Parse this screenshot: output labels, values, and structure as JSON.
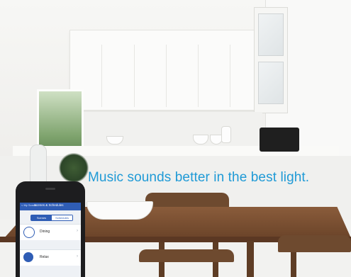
{
  "advert": {
    "tagline": "Music sounds better in the best light."
  },
  "phone_app": {
    "nav_back": "< My Sonos",
    "nav_title": "Scenes & Schedules",
    "segments": [
      "Scenes",
      "Schedules"
    ],
    "selected_segment": "Scenes",
    "rows": [
      {
        "label": "Dining",
        "icon": "dining-scene-icon"
      },
      {
        "label": "Relax",
        "icon": "relax-scene-icon"
      }
    ]
  },
  "colors": {
    "tagline": "#1f9ad6",
    "app_accent": "#2f5db5"
  }
}
